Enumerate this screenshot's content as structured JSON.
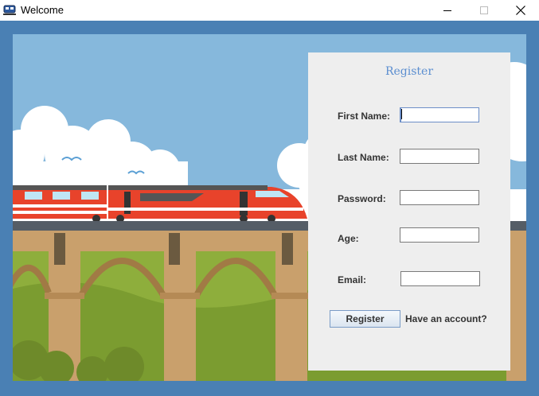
{
  "window": {
    "title": "Welcome",
    "icons": {
      "app": "train-icon",
      "minimize": "minimize-icon",
      "maximize": "maximize-icon",
      "close": "close-icon"
    }
  },
  "colors": {
    "frame": "#4a80b4",
    "sky": "#86b8dc",
    "panel": "#eeeeee",
    "title_accent": "#5b8ed0",
    "train_red": "#e8432b",
    "grass": "#8eae3c",
    "bridge": "#c9a06c"
  },
  "form": {
    "title": "Register",
    "fields": [
      {
        "label": "First Name:",
        "value": ""
      },
      {
        "label": "Last Name:",
        "value": ""
      },
      {
        "label": "Password:",
        "value": ""
      },
      {
        "label": "Age:",
        "value": ""
      },
      {
        "label": "Email:",
        "value": ""
      }
    ],
    "register_button": "Register",
    "login_link": "Have an account?"
  }
}
